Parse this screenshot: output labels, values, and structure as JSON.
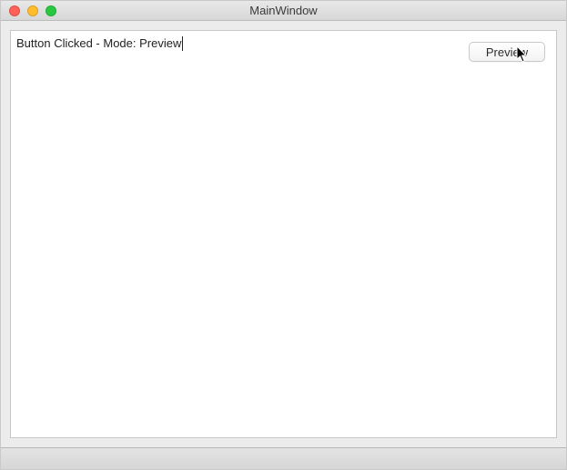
{
  "window": {
    "title": "MainWindow"
  },
  "content": {
    "status_text": "Button Clicked - Mode: Preview"
  },
  "buttons": {
    "preview_label": "Preview"
  }
}
